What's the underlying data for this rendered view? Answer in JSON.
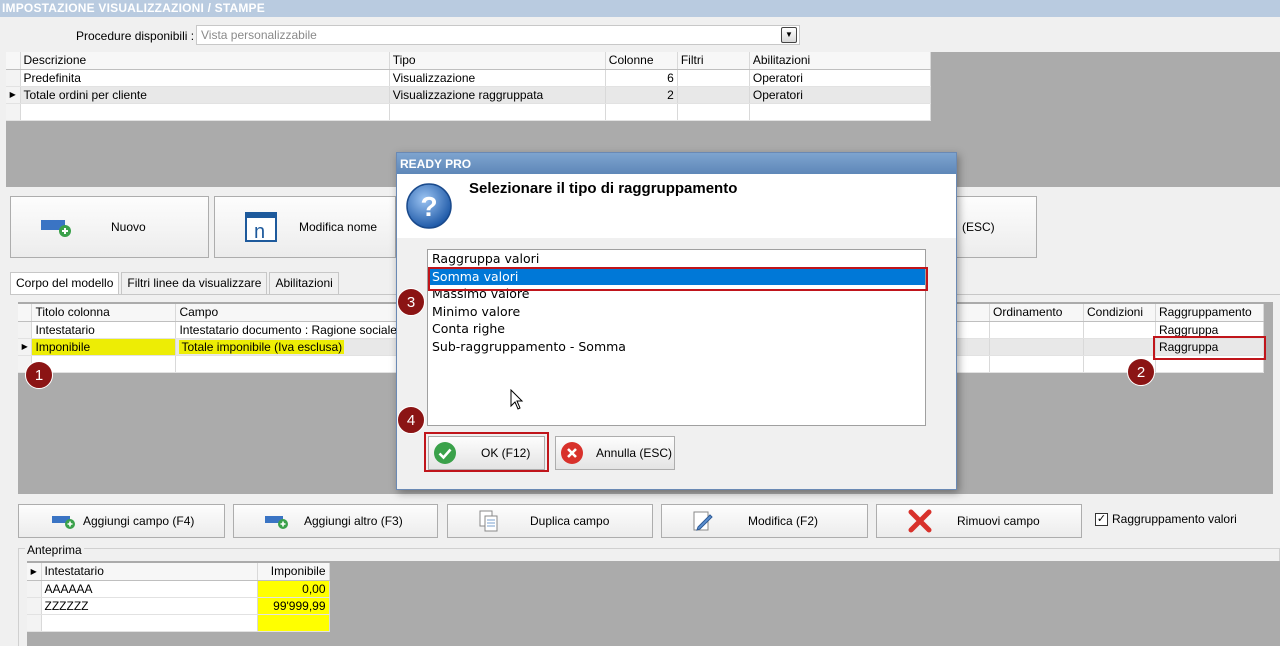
{
  "window": {
    "title": "IMPOSTAZIONE VISUALIZZAZIONI / STAMPE"
  },
  "procedure": {
    "label": "Procedure disponibili :",
    "value": "Vista personalizzabile"
  },
  "top_grid": {
    "headers": [
      "Descrizione",
      "Tipo",
      "Colonne",
      "Filtri",
      "Abilitazioni"
    ],
    "rows": [
      [
        "Predefinita",
        "Visualizzazione",
        "6",
        "",
        "Operatori"
      ],
      [
        "Totale ordini per cliente",
        "Visualizzazione raggruppata",
        "2",
        "",
        "Operatori"
      ]
    ]
  },
  "toolbar": {
    "nuovo": "Nuovo",
    "modifica_nome": "Modifica nome",
    "esc": "(ESC)"
  },
  "tabs": [
    "Corpo del modello",
    "Filtri linee da visualizzare",
    "Abilitazioni"
  ],
  "mid_grid": {
    "headers": [
      "Titolo colonna",
      "Campo",
      "Ordinamento",
      "Condizioni",
      "Raggruppamento"
    ],
    "rows": [
      [
        "Intestatario",
        "Intestatario documento : Ragione sociale",
        "",
        "",
        "Raggruppa"
      ],
      [
        "Imponibile",
        "Totale imponibile (Iva esclusa)",
        "",
        "",
        "Raggruppa"
      ]
    ]
  },
  "bottom_buttons": {
    "aggiungi_campo": "Aggiungi campo (F4)",
    "aggiungi_altro": "Aggiungi altro (F3)",
    "duplica": "Duplica campo",
    "modifica": "Modifica (F2)",
    "rimuovi": "Rimuovi campo",
    "raggruppamento_label": "Raggruppamento valori",
    "raggruppamento_checked": true
  },
  "anteprima": {
    "label": "Anteprima",
    "headers": [
      "Intestatario",
      "Imponibile"
    ],
    "rows": [
      [
        "AAAAAA",
        "0,00"
      ],
      [
        "ZZZZZZ",
        "99'999,99"
      ]
    ]
  },
  "dialog": {
    "title": "READY PRO",
    "question": "Selezionare il tipo di raggruppamento",
    "options": [
      "Raggruppa valori",
      "Somma valori",
      "Massimo valore",
      "Minimo valore",
      "Conta righe",
      "Sub-raggruppamento - Somma"
    ],
    "selected_index": 1,
    "ok": "OK (F12)",
    "annulla": "Annulla (ESC)"
  },
  "callouts": [
    "1",
    "2",
    "3",
    "4"
  ],
  "colors": {
    "accent": "#0078d7",
    "callout": "#8b1414",
    "highlight": "#eded05"
  }
}
